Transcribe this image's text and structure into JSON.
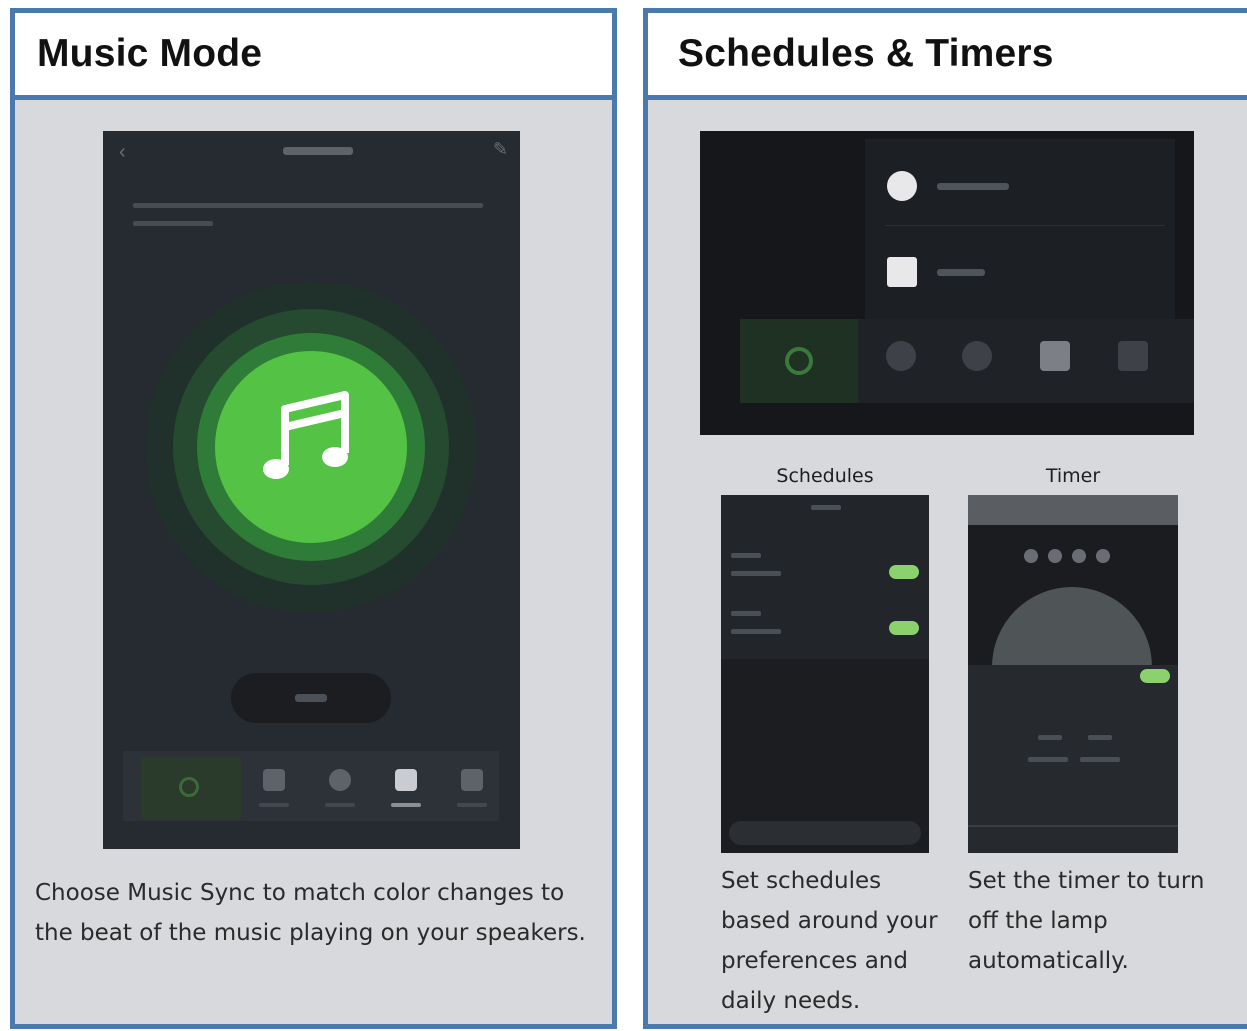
{
  "music_mode": {
    "title": "Music Mode",
    "caption": "Choose Music Sync to match color changes to the beat of the music playing on your speakers.",
    "accent_color": "#53c245"
  },
  "schedules_timers": {
    "title": "Schedules & Timers",
    "schedules": {
      "label": "Schedules",
      "caption": "Set schedules based around your preferences and daily needs."
    },
    "timer": {
      "label": "Timer",
      "caption": "Set the timer to turn off the lamp automatically."
    }
  },
  "colors": {
    "border": "#4a79ad",
    "panel_background": "#d8d9dc"
  },
  "icons": [
    "music-note-icon",
    "power-icon",
    "back-icon",
    "edit-icon",
    "schedule-icon",
    "timer-icon"
  ]
}
